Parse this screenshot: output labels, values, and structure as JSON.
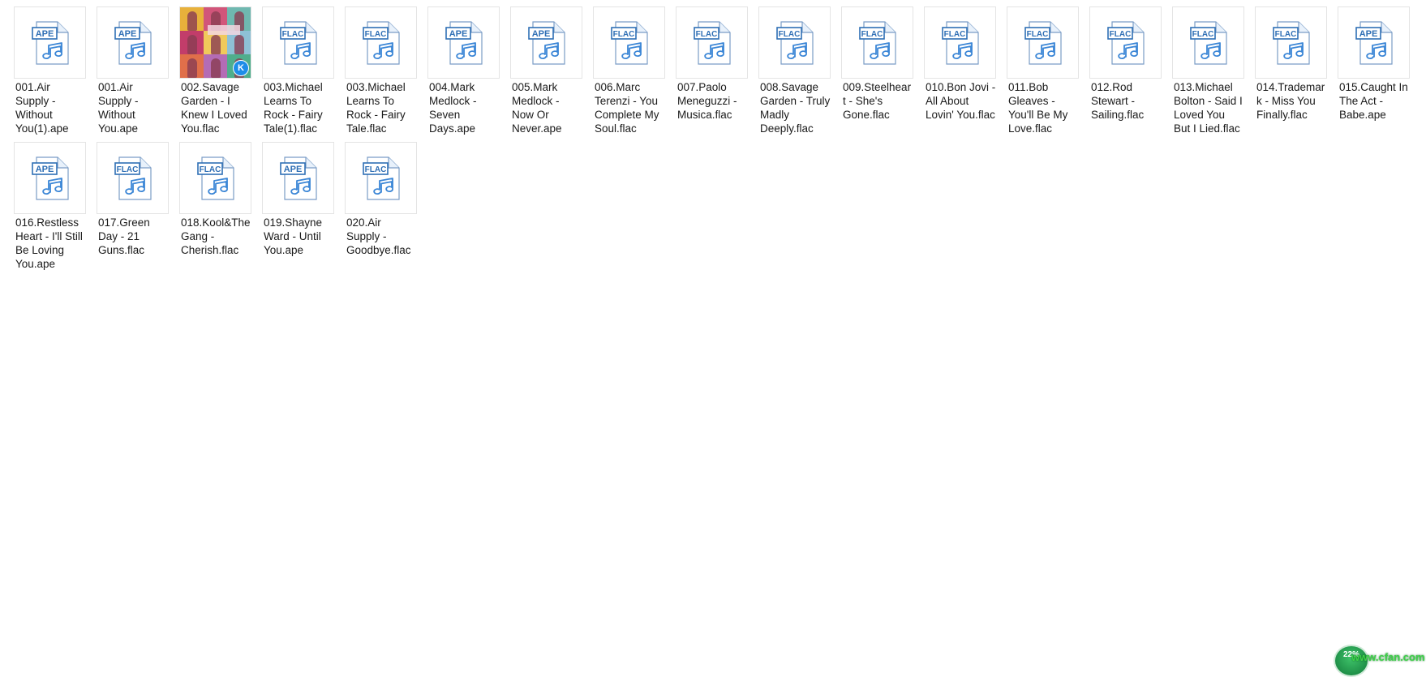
{
  "files": [
    {
      "name": "001.Air Supply - Without You(1).ape",
      "format_label": "APE"
    },
    {
      "name": "001.Air Supply - Without You.ape",
      "format_label": "APE"
    },
    {
      "name": "002.Savage Garden - I Knew I Loved You.flac",
      "format_label": "FLAC",
      "thumbnail": "album-art"
    },
    {
      "name": "003.Michael Learns To Rock - Fairy Tale(1).flac",
      "format_label": "FLAC"
    },
    {
      "name": "003.Michael Learns To Rock - Fairy Tale.flac",
      "format_label": "FLAC"
    },
    {
      "name": "004.Mark Medlock - Seven Days.ape",
      "format_label": "APE"
    },
    {
      "name": "005.Mark Medlock - Now Or Never.ape",
      "format_label": "APE"
    },
    {
      "name": "006.Marc Terenzi - You Complete My Soul.flac",
      "format_label": "FLAC"
    },
    {
      "name": "007.Paolo Meneguzzi - Musica.flac",
      "format_label": "FLAC"
    },
    {
      "name": "008.Savage Garden - Truly Madly Deeply.flac",
      "format_label": "FLAC"
    },
    {
      "name": "009.Steelheart - She's Gone.flac",
      "format_label": "FLAC"
    },
    {
      "name": "010.Bon Jovi - All About Lovin' You.flac",
      "format_label": "FLAC"
    },
    {
      "name": "011.Bob Gleaves - You'll Be My Love.flac",
      "format_label": "FLAC"
    },
    {
      "name": "012.Rod Stewart - Sailing.flac",
      "format_label": "FLAC"
    },
    {
      "name": "013.Michael Bolton - Said I Loved You But I Lied.flac",
      "format_label": "FLAC"
    },
    {
      "name": "014.Trademark - Miss You Finally.flac",
      "format_label": "FLAC"
    },
    {
      "name": "015.Caught In The Act - Babe.ape",
      "format_label": "APE"
    },
    {
      "name": "016.Restless Heart - I'll Still Be Loving You.ape",
      "format_label": "APE"
    },
    {
      "name": "017.Green Day - 21 Guns.flac",
      "format_label": "FLAC"
    },
    {
      "name": "018.Kool&The Gang - Cherish.flac",
      "format_label": "FLAC"
    },
    {
      "name": "019.Shayne Ward - Until You.ape",
      "format_label": "APE"
    },
    {
      "name": "020.Air Supply - Goodbye.flac",
      "format_label": "FLAC"
    }
  ],
  "player_badge": "K",
  "tray": {
    "gauge_value": "22%",
    "watermark": "www.cfan.com"
  },
  "colors": {
    "icon_blue": "#2f6fb5",
    "icon_light": "#e8f1fb",
    "badge_blue": "#1e8de8",
    "watermark_green": "#3fd04a"
  },
  "icons": {
    "audio_file": "music-note-file-icon",
    "player": "kugou-player-badge-icon"
  }
}
